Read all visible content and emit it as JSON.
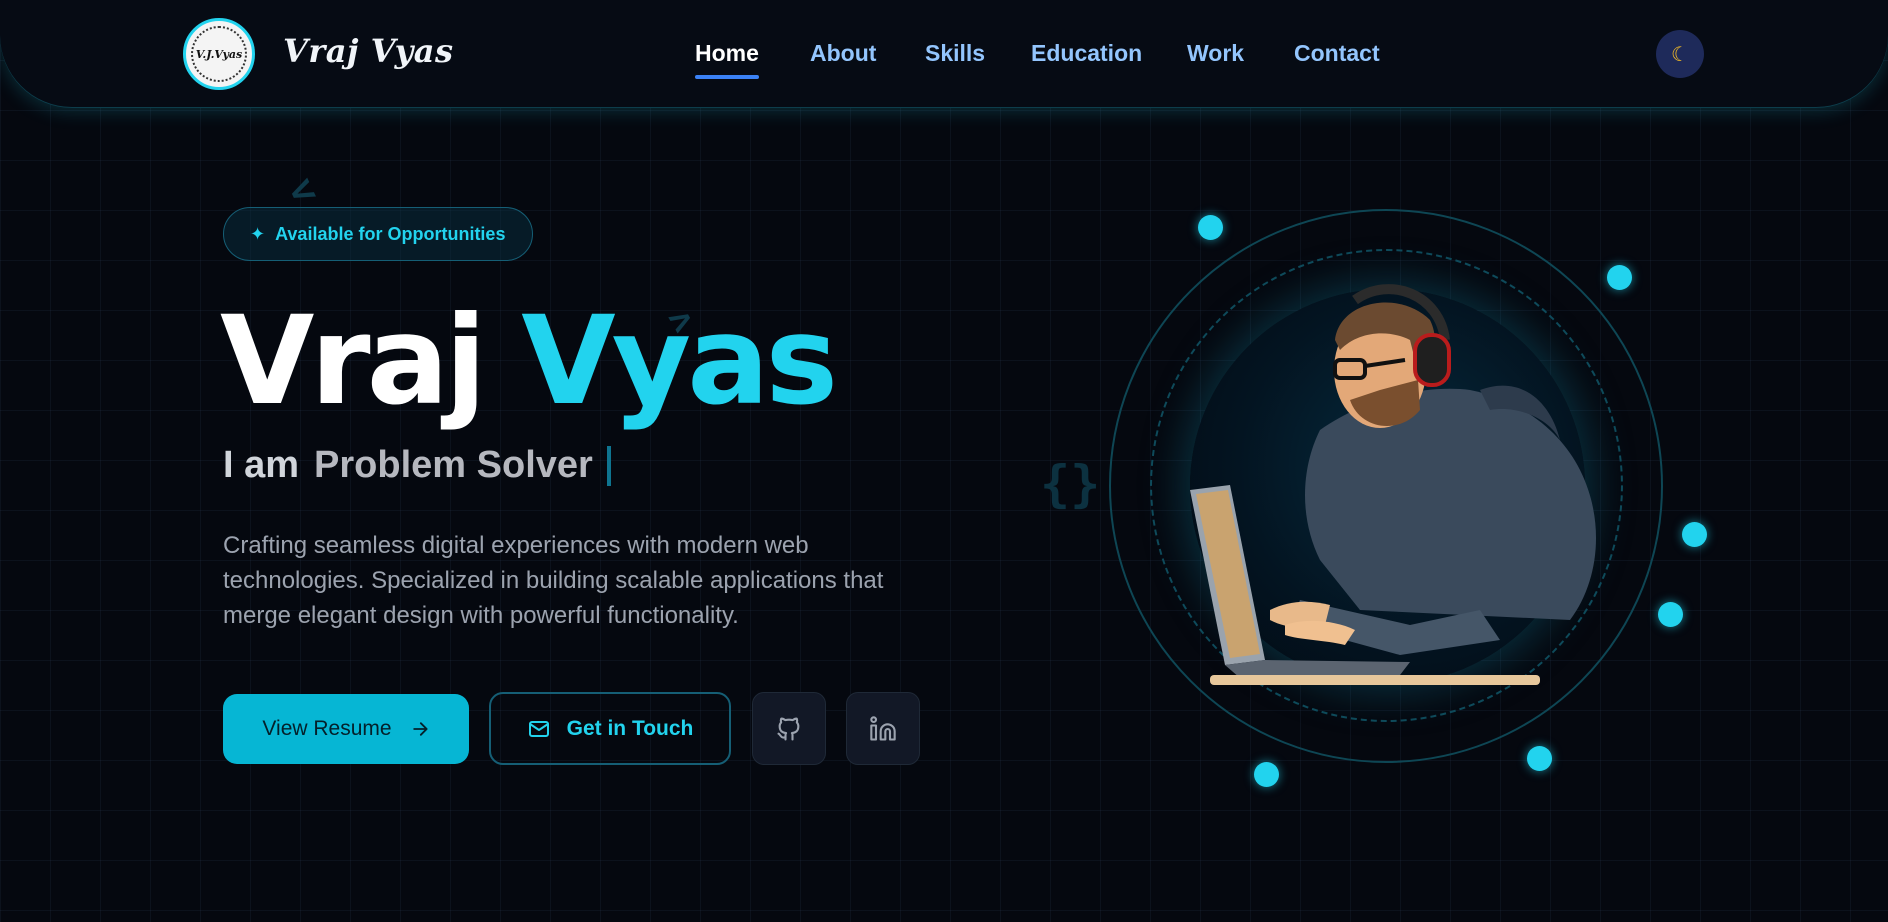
{
  "nav": {
    "logo_text": "V.J.Vyas",
    "brand": "Vraj Vyas",
    "links": [
      {
        "label": "Home",
        "active": true
      },
      {
        "label": "About",
        "active": false
      },
      {
        "label": "Skills",
        "active": false
      },
      {
        "label": "Education",
        "active": false
      },
      {
        "label": "Work",
        "active": false
      },
      {
        "label": "Contact",
        "active": false
      }
    ],
    "theme_toggle_icon": "moon-icon"
  },
  "hero": {
    "badge": "Available for Opportunities",
    "name_first": "Vraj",
    "name_last": "Vyas",
    "role_prefix": "I am",
    "role": "Problem Solver",
    "description": "Crafting seamless digital experiences with modern web technologies. Specialized in building scalable applications that merge elegant design with powerful functionality.",
    "buttons": {
      "resume": "View Resume",
      "contact": "Get in Touch"
    },
    "socials": [
      {
        "icon": "github-icon"
      },
      {
        "icon": "linkedin-icon"
      }
    ]
  },
  "colors": {
    "accent": "#22d3ee",
    "background": "#05080f",
    "nav_active_underline": "#3b82f6",
    "nav_link": "#93c5fd"
  }
}
